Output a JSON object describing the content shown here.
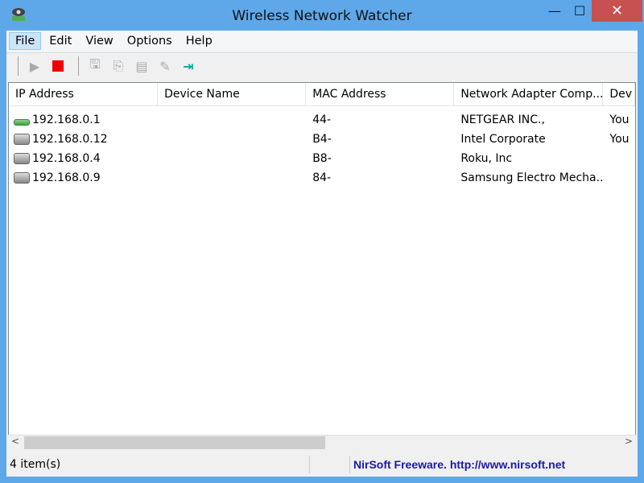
{
  "window": {
    "title": "Wireless Network Watcher",
    "minimize": "—",
    "maximize": "☐",
    "close": "✕"
  },
  "menu": [
    {
      "label": "File"
    },
    {
      "label": "Edit"
    },
    {
      "label": "View"
    },
    {
      "label": "Options"
    },
    {
      "label": "Help"
    }
  ],
  "columns": [
    "IP Address",
    "Device Name",
    "MAC Address",
    "Network Adapter Comp...",
    "Dev"
  ],
  "rows": [
    {
      "ip": "192.168.0.1",
      "name": "",
      "mac": "44-",
      "adapter": "NETGEAR INC.,",
      "device": "You",
      "icon": "router-icon"
    },
    {
      "ip": "192.168.0.12",
      "name": "",
      "mac": "B4-",
      "adapter": "Intel Corporate",
      "device": "You",
      "icon": "computer-icon"
    },
    {
      "ip": "192.168.0.4",
      "name": "",
      "mac": "B8-",
      "adapter": "Roku, Inc",
      "device": "",
      "icon": "computer-icon"
    },
    {
      "ip": "192.168.0.9",
      "name": "",
      "mac": "84-",
      "adapter": "Samsung Electro Mecha...",
      "device": "",
      "icon": "computer-icon"
    }
  ],
  "status": {
    "count": "4 item(s)",
    "link": "NirSoft Freeware.  http://www.nirsoft.net"
  }
}
